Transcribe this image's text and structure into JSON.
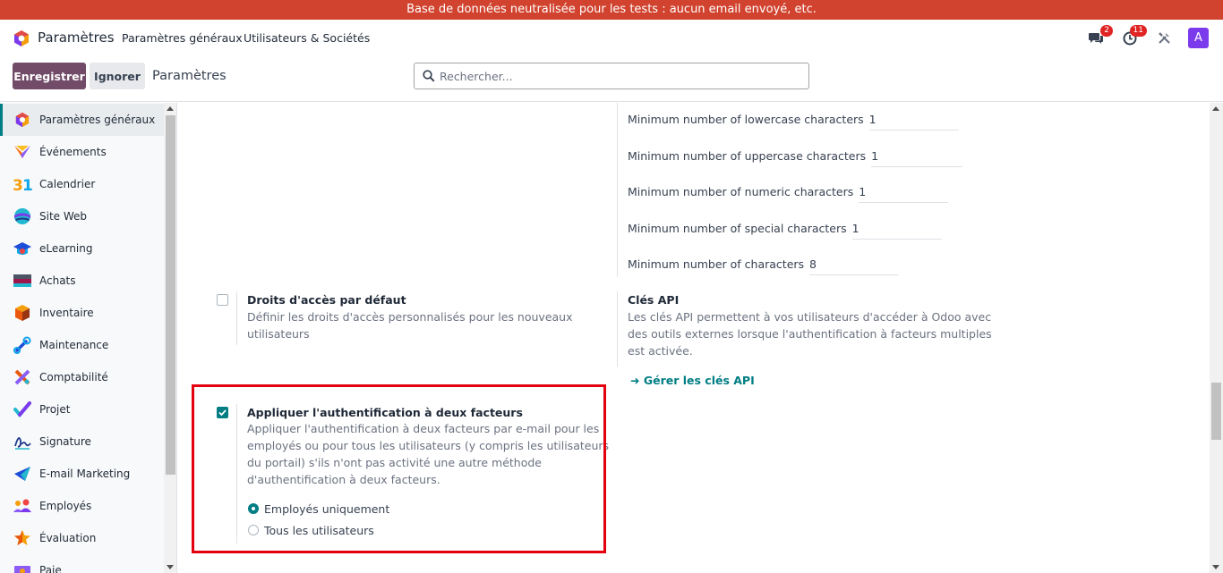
{
  "banner": {
    "text": "Base de données neutralisée pour les tests : aucun email envoyé, etc."
  },
  "topnav": {
    "app_title": "Paramètres",
    "menu1": "Paramètres généraux",
    "menu2": "Utilisateurs & Sociétés",
    "messages_count": "2",
    "activities_count": "11",
    "avatar_letter": "A"
  },
  "controlbar": {
    "save_label": "Enregistrer",
    "discard_label": "Ignorer",
    "breadcrumb": "Paramètres",
    "search_placeholder": "Rechercher..."
  },
  "sidebar": {
    "items": [
      {
        "label": "Paramètres généraux",
        "icon": "settings-app-icon"
      },
      {
        "label": "Événements",
        "icon": "events-app-icon"
      },
      {
        "label": "Calendrier",
        "icon": "calendar-app-icon"
      },
      {
        "label": "Site Web",
        "icon": "website-app-icon"
      },
      {
        "label": "eLearning",
        "icon": "elearning-app-icon"
      },
      {
        "label": "Achats",
        "icon": "purchase-app-icon"
      },
      {
        "label": "Inventaire",
        "icon": "inventory-app-icon"
      },
      {
        "label": "Maintenance",
        "icon": "maintenance-app-icon"
      },
      {
        "label": "Comptabilité",
        "icon": "accounting-app-icon"
      },
      {
        "label": "Projet",
        "icon": "project-app-icon"
      },
      {
        "label": "Signature",
        "icon": "signature-app-icon"
      },
      {
        "label": "E-mail Marketing",
        "icon": "email-marketing-app-icon"
      },
      {
        "label": "Employés",
        "icon": "employees-app-icon"
      },
      {
        "label": "Évaluation",
        "icon": "appraisal-app-icon"
      },
      {
        "label": "Paie",
        "icon": "payroll-app-icon"
      }
    ]
  },
  "password_policy": [
    {
      "label": "Minimum number of lowercase characters",
      "value": "1"
    },
    {
      "label": "Minimum number of uppercase characters",
      "value": "1"
    },
    {
      "label": "Minimum number of numeric characters",
      "value": "1"
    },
    {
      "label": "Minimum number of special characters",
      "value": "1"
    },
    {
      "label": "Minimum number of characters",
      "value": "8"
    }
  ],
  "default_access": {
    "title": "Droits d'accès par défaut",
    "desc_line1": "Définir les droits d'accès personnalisés pour les nouveaux",
    "desc_line2": "utilisateurs",
    "checked": false
  },
  "api_keys": {
    "title": "Clés API",
    "desc_line1": "Les clés API permettent à vos utilisateurs d'accéder à Odoo avec",
    "desc_line2": "des outils externes lorsque l'authentification à facteurs multiples",
    "desc_line3": "est activée.",
    "link": "Gérer les clés API"
  },
  "two_factor": {
    "title": "Appliquer l'authentification à deux facteurs",
    "desc_line1": "Appliquer l'authentification à deux facteurs par e-mail pour les",
    "desc_line2": "employés ou pour tous les utilisateurs (y compris les utilisateurs",
    "desc_line3": "du portail) s'ils n'ont pas activité une autre méthode",
    "desc_line4": "d'authentification à deux facteurs.",
    "checked": true,
    "option_employees": "Employés uniquement",
    "option_all": "Tous les utilisateurs",
    "selected": "Employés uniquement"
  },
  "colors": {
    "brand": "#714b67",
    "accent": "#017e84",
    "banner": "#d1432f",
    "highlight": "#e3000f"
  }
}
